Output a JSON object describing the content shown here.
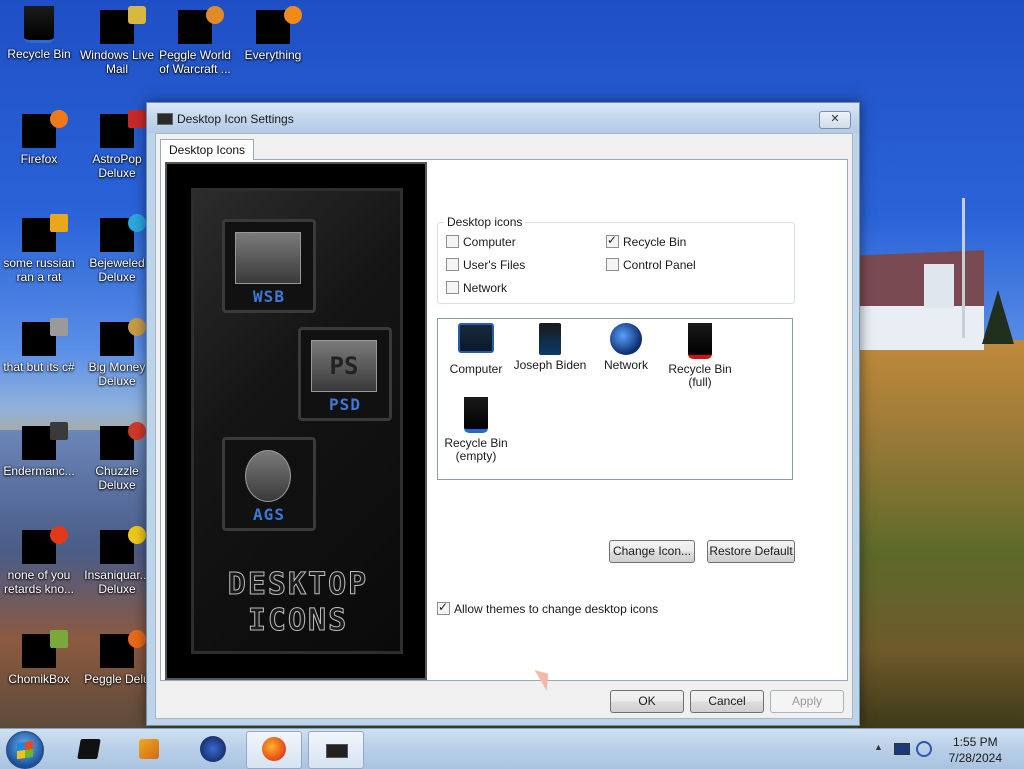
{
  "desktop": {
    "icons": [
      {
        "label": "Recycle Bin",
        "icon": "recycle-bin-icon"
      },
      {
        "label": "Windows Live Mail",
        "icon": "mail-icon"
      },
      {
        "label": "Peggle World of Warcraft ...",
        "icon": "game-icon"
      },
      {
        "label": "Everything",
        "icon": "search-app-icon"
      },
      {
        "label": "Firefox",
        "icon": "firefox-icon"
      },
      {
        "label": "AstroPop Deluxe",
        "icon": "game-icon"
      },
      {
        "label": "some russian ran a rat",
        "icon": "app-icon"
      },
      {
        "label": "Bejeweled Deluxe",
        "icon": "game-icon"
      },
      {
        "label": "that but its c#",
        "icon": "app-icon"
      },
      {
        "label": "Big Money Deluxe",
        "icon": "game-icon"
      },
      {
        "label": "Endermanc...",
        "icon": "app-icon"
      },
      {
        "label": "Chuzzle Deluxe",
        "icon": "game-icon"
      },
      {
        "label": "none of you retards kno...",
        "icon": "app-icon"
      },
      {
        "label": "Insaniquar... Deluxe",
        "icon": "game-icon"
      },
      {
        "label": "ChomikBox",
        "icon": "app-icon"
      },
      {
        "label": "Peggle Delu",
        "icon": "game-icon"
      }
    ]
  },
  "dialog": {
    "title": "Desktop Icon Settings",
    "close_label": "✕",
    "tab_label": "Desktop Icons",
    "preview": {
      "tile_labels": [
        "WSB",
        "PSD",
        "AGS"
      ],
      "tile_ps": "PS",
      "title_line1": "DESKTOP",
      "title_line2": "ICONS"
    },
    "group_label": "Desktop icons",
    "checkboxes": [
      {
        "label": "Computer",
        "checked": false
      },
      {
        "label": "Recycle Bin",
        "checked": true
      },
      {
        "label": "User's Files",
        "checked": false
      },
      {
        "label": "Control Panel",
        "checked": false
      },
      {
        "label": "Network",
        "checked": false
      }
    ],
    "icon_list": [
      {
        "line1": "Computer",
        "line2": "",
        "icon": "monitor-icon"
      },
      {
        "line1": "Joseph Biden",
        "line2": "",
        "icon": "user-folder-icon"
      },
      {
        "line1": "Network",
        "line2": "",
        "icon": "network-globe-icon"
      },
      {
        "line1": "Recycle Bin",
        "line2": "(full)",
        "icon": "recycle-bin-full-icon"
      },
      {
        "line1": "Recycle Bin",
        "line2": "(empty)",
        "icon": "recycle-bin-empty-icon"
      }
    ],
    "change_icon_label": "Change Icon...",
    "restore_default_label": "Restore Default",
    "allow_themes_label": "Allow themes to change desktop icons",
    "allow_themes_checked": true,
    "ok_label": "OK",
    "cancel_label": "Cancel",
    "apply_label": "Apply"
  },
  "taskbar": {
    "clock_time": "1:55 PM",
    "clock_date": "7/28/2024",
    "tray_arrow": "▲"
  }
}
